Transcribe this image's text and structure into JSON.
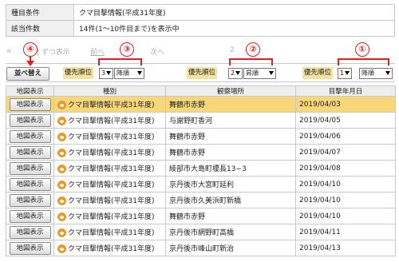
{
  "info": {
    "rows": [
      {
        "label": "種目条件",
        "value": "クマ目撃情報(平成31年度)"
      },
      {
        "label": "該当件数",
        "value": "14件(1〜10件目まで)を表示中"
      }
    ]
  },
  "pager": {
    "first": "«",
    "prev": "前へ",
    "p1": "1",
    "p2": "2",
    "next": "次へ",
    "last": "»",
    "partial": "| ずつ表示"
  },
  "controls": {
    "sort_button": "並べ替え",
    "priorities": [
      {
        "label": "優先順位",
        "rank": "3",
        "order": "降順"
      },
      {
        "label": "優先順位",
        "rank": "2",
        "order": "昇順"
      },
      {
        "label": "優先順位",
        "rank": "1",
        "order": "降順"
      }
    ]
  },
  "annotations": {
    "n1": "①",
    "n2": "②",
    "n3": "③",
    "n4": "④"
  },
  "table": {
    "headers": [
      "地図表示",
      "種別",
      "観察場所",
      "目撃年月日"
    ],
    "map_button": "地図表示",
    "rows": [
      {
        "type": "クマ目撃情報(平成31年度)",
        "place": "舞鶴市赤野",
        "date": "2019/04/03",
        "highlight": true
      },
      {
        "type": "クマ目撃情報(平成31年度)",
        "place": "与謝野町香河",
        "date": "2019/04/05",
        "highlight": false
      },
      {
        "type": "クマ目撃情報(平成31年度)",
        "place": "舞鶴市赤野",
        "date": "2019/04/06",
        "highlight": false
      },
      {
        "type": "クマ目撃情報(平成31年度)",
        "place": "舞鶴市赤野",
        "date": "2019/04/07",
        "highlight": false
      },
      {
        "type": "クマ目撃情報(平成31年度)",
        "place": "綾部市大島町榎長13−3",
        "date": "2019/04/08",
        "highlight": false
      },
      {
        "type": "クマ目撃情報(平成31年度)",
        "place": "京丹後市大宮町延利",
        "date": "2019/04/10",
        "highlight": false
      },
      {
        "type": "クマ目撃情報(平成31年度)",
        "place": "京丹後市久美浜町新橋",
        "date": "2019/04/10",
        "highlight": false
      },
      {
        "type": "クマ目撃情報(平成31年度)",
        "place": "舞鶴市赤野",
        "date": "2019/04/10",
        "highlight": false
      },
      {
        "type": "クマ目撃情報(平成31年度)",
        "place": "京丹後市網野町高橋",
        "date": "2019/04/11",
        "highlight": false
      },
      {
        "type": "クマ目撃情報(平成31年度)",
        "place": "京丹後市峰山町新治",
        "date": "2019/04/13",
        "highlight": false
      }
    ]
  },
  "colors": {
    "highlight_row": "#f7d77a",
    "annotation": "#e01e1e",
    "priority_label_bg": "#f3e2a0"
  }
}
